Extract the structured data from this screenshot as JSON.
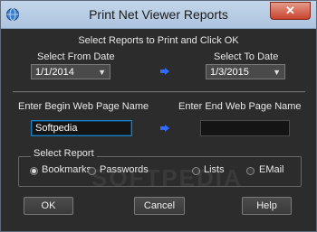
{
  "window": {
    "title": "Print Net Viewer Reports",
    "close_label": "✕"
  },
  "header": {
    "instruction": "Select Reports to Print and Click OK"
  },
  "dates": {
    "from_label": "Select From Date",
    "from_value": "1/1/2014",
    "to_label": "Select To Date",
    "to_value": "1/3/2015"
  },
  "pages": {
    "begin_label": "Enter Begin Web Page Name",
    "begin_value": "Softpedia",
    "end_label": "Enter End Web Page Name",
    "end_value": ""
  },
  "report": {
    "group_label": "Select Report",
    "options": [
      {
        "label": "Bookmarks",
        "checked": true
      },
      {
        "label": "Passwords",
        "checked": false
      },
      {
        "label": "Lists",
        "checked": false
      },
      {
        "label": "EMail",
        "checked": false
      }
    ]
  },
  "buttons": {
    "ok": "OK",
    "cancel": "Cancel",
    "help": "Help"
  },
  "watermark": "SOFTPEDIA",
  "colors": {
    "arrow": "#2f6bff",
    "focus_border": "#1d7ec0"
  }
}
